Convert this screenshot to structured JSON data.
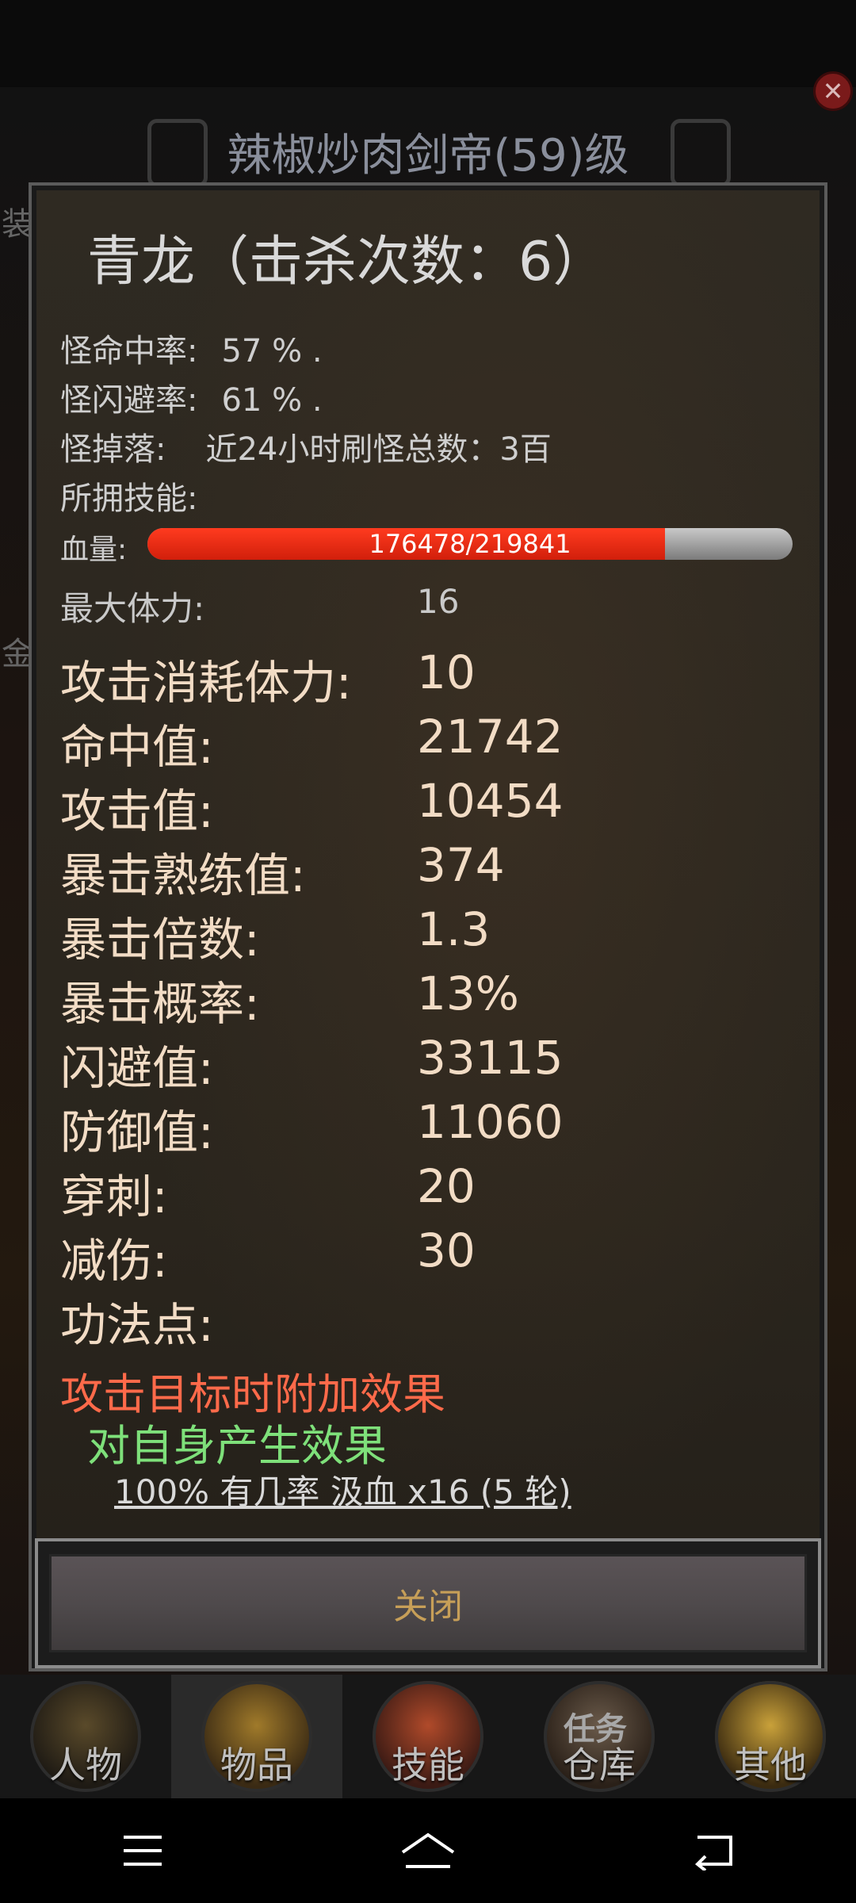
{
  "background": {
    "title": "辣椒炒肉剑帝(59)级",
    "side_chars": [
      "装",
      "金"
    ]
  },
  "modal": {
    "title": "青龙（击杀次数：6）",
    "hit_rate_label": "怪命中率:",
    "hit_rate_value": "57 % .",
    "dodge_rate_label": "怪闪避率:",
    "dodge_rate_value": "61 % .",
    "drop_label": "怪掉落:",
    "drop_value": "近24小时刷怪总数：3百",
    "skills_label": "所拥技能:",
    "hp_label": "血量:",
    "hp_text": "176478/219841",
    "hp_fraction": 0.8028,
    "max_stamina_label": "最大体力:",
    "max_stamina_value": "16",
    "stats": [
      {
        "label": "攻击消耗体力:",
        "value": "10"
      },
      {
        "label": "命中值:",
        "value": "21742"
      },
      {
        "label": "攻击值:",
        "value": "10454"
      },
      {
        "label": "暴击熟练值:",
        "value": "374"
      },
      {
        "label": "暴击倍数:",
        "value": "1.3"
      },
      {
        "label": "暴击概率:",
        "value": "13%"
      },
      {
        "label": "闪避值:",
        "value": "33115"
      },
      {
        "label": "防御值:",
        "value": "11060"
      },
      {
        "label": "穿刺:",
        "value": "20"
      },
      {
        "label": "减伤:",
        "value": "30"
      },
      {
        "label": "功法点:",
        "value": ""
      }
    ],
    "effect_title": "攻击目标时附加效果",
    "effect_self": "对自身产生效果",
    "effect_detail": "100% 有几率 汲血 x16 (5 轮)",
    "close_label": "关闭"
  },
  "nav": {
    "items": [
      {
        "label": "人物",
        "icon": "character-icon"
      },
      {
        "label": "物品",
        "icon": "armor-icon",
        "active": true
      },
      {
        "label": "技能",
        "icon": "sword-icon"
      },
      {
        "label": "仓库",
        "icon": "chest-icon",
        "badge": "任务"
      },
      {
        "label": "其他",
        "icon": "trophy-icon"
      }
    ]
  },
  "colors": {
    "hp_fill": "#e0260f",
    "effect_red": "#ff6a4a",
    "effect_green": "#7ee07a",
    "close_text": "#c79f58"
  }
}
